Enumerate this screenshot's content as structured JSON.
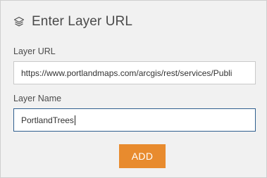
{
  "header": {
    "icon": "layers-icon",
    "title": "Enter Layer URL"
  },
  "form": {
    "layer_url_label": "Layer URL",
    "layer_url_value": "https://www.portlandmaps.com/arcgis/rest/services/Publi",
    "layer_name_label": "Layer Name",
    "layer_name_value": "PortlandTrees",
    "add_button_label": "ADD"
  },
  "colors": {
    "panel_background": "#f1f1f1",
    "add_button": "#e88b2e",
    "focused_border": "#2f5f8f"
  }
}
